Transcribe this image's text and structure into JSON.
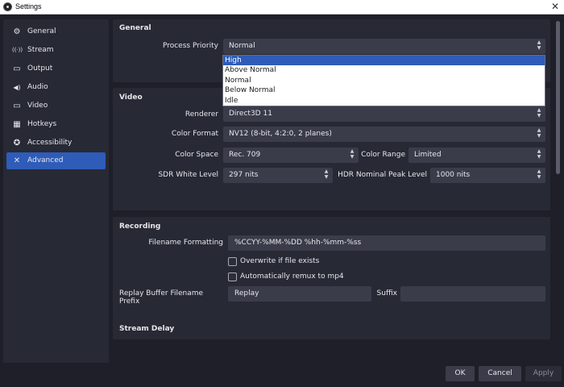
{
  "window": {
    "title": "Settings",
    "close": "✕"
  },
  "sidebar": {
    "items": [
      {
        "label": "General",
        "icon": "gear-icon",
        "glyph": "⚙"
      },
      {
        "label": "Stream",
        "icon": "antenna-icon",
        "glyph": "((·))"
      },
      {
        "label": "Output",
        "icon": "output-icon",
        "glyph": "▭"
      },
      {
        "label": "Audio",
        "icon": "speaker-icon",
        "glyph": "◀)"
      },
      {
        "label": "Video",
        "icon": "monitor-icon",
        "glyph": "▭"
      },
      {
        "label": "Hotkeys",
        "icon": "keyboard-icon",
        "glyph": "▦"
      },
      {
        "label": "Accessibility",
        "icon": "accessibility-icon",
        "glyph": "✪"
      },
      {
        "label": "Advanced",
        "icon": "wrench-icon",
        "glyph": "✕",
        "active": true
      }
    ]
  },
  "general": {
    "title": "General",
    "process_priority": {
      "label": "Process Priority",
      "value": "Normal",
      "options": [
        "High",
        "Above Normal",
        "Normal",
        "Below Normal",
        "Idle"
      ],
      "highlighted": "High"
    }
  },
  "video": {
    "title": "Video",
    "renderer": {
      "label": "Renderer",
      "value": "Direct3D 11"
    },
    "color_format": {
      "label": "Color Format",
      "value": "NV12 (8-bit, 4:2:0, 2 planes)"
    },
    "color_space": {
      "label": "Color Space",
      "value": "Rec. 709"
    },
    "color_range": {
      "label": "Color Range",
      "value": "Limited"
    },
    "sdr_white_level": {
      "label": "SDR White Level",
      "value": "297 nits"
    },
    "hdr_peak_level": {
      "label": "HDR Nominal Peak Level",
      "value": "1000 nits"
    }
  },
  "recording": {
    "title": "Recording",
    "filename_formatting": {
      "label": "Filename Formatting",
      "value": "%CCYY-%MM-%DD %hh-%mm-%ss"
    },
    "overwrite": {
      "label": "Overwrite if file exists",
      "checked": false
    },
    "remux": {
      "label": "Automatically remux to mp4",
      "checked": false
    },
    "replay_prefix": {
      "label": "Replay Buffer Filename Prefix",
      "value": "Replay"
    },
    "suffix": {
      "label": "Suffix",
      "value": ""
    }
  },
  "stream_delay": {
    "title": "Stream Delay"
  },
  "footer": {
    "ok": "OK",
    "cancel": "Cancel",
    "apply": "Apply"
  }
}
